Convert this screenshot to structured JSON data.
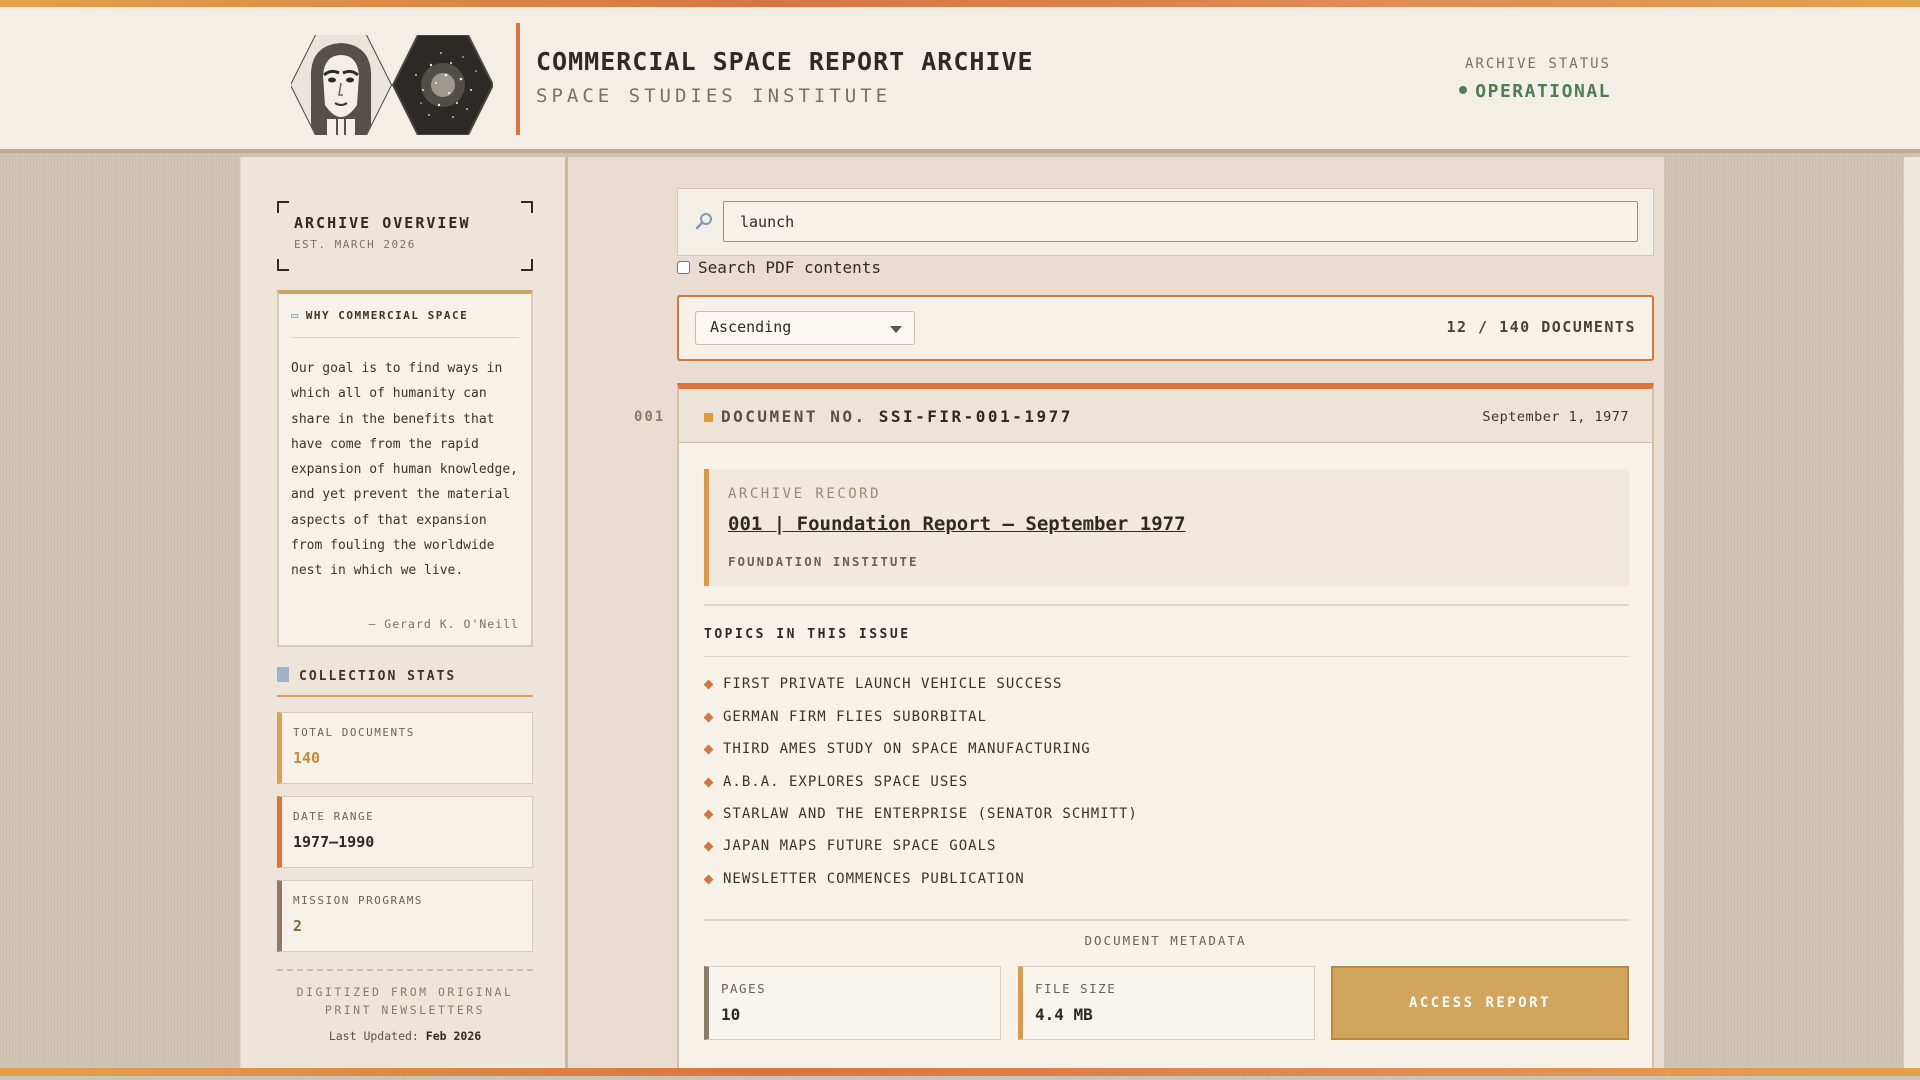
{
  "header": {
    "title": "COMMERCIAL SPACE REPORT ARCHIVE",
    "subtitle": "SPACE STUDIES INSTITUTE",
    "status_label": "ARCHIVE STATUS",
    "status_value": "OPERATIONAL"
  },
  "sidebar": {
    "overview_title": "ARCHIVE OVERVIEW",
    "overview_est": "EST. MARCH 2026",
    "quote_heading": "WHY COMMERCIAL SPACE",
    "quote_text": "Our goal is to find ways in which all of humanity can share in the benefits that have come from the rapid expansion of human knowledge, and yet prevent the material aspects of that expansion from fouling the worldwide nest in which we live.",
    "quote_author": "— Gerard K. O'Neill",
    "stats_heading": "COLLECTION STATS",
    "stats": [
      {
        "label": "TOTAL DOCUMENTS",
        "value": "140"
      },
      {
        "label": "DATE RANGE",
        "value": "1977–1990"
      },
      {
        "label": "MISSION PROGRAMS",
        "value": "2"
      }
    ],
    "digitized": "DIGITIZED FROM ORIGINAL PRINT NEWSLETTERS",
    "updated_label": "Last Updated:",
    "updated_value": "Feb 2026"
  },
  "search": {
    "value": "launch",
    "pdf_label": "Search PDF contents",
    "pdf_checked": false
  },
  "sort": {
    "selected": "Ascending",
    "count": "12 / 140 DOCUMENTS"
  },
  "document": {
    "index": "001",
    "doc_no_label": "DOCUMENT NO.",
    "doc_no": "SSI-FIR-001-1977",
    "date": "September 1, 1977",
    "record_label": "ARCHIVE RECORD",
    "record_title": "001 | Foundation Report — September 1977",
    "record_org": "FOUNDATION INSTITUTE",
    "topics_heading": "TOPICS IN THIS ISSUE",
    "topics": [
      "FIRST PRIVATE LAUNCH VEHICLE SUCCESS",
      "GERMAN FIRM FLIES SUBORBITAL",
      "THIRD AMES STUDY ON SPACE MANUFACTURING",
      "A.B.A. EXPLORES SPACE USES",
      "STARLAW AND THE ENTERPRISE (SENATOR SCHMITT)",
      "JAPAN MAPS FUTURE SPACE GOALS",
      "NEWSLETTER COMMENCES PUBLICATION"
    ],
    "metadata_heading": "DOCUMENT METADATA",
    "pages_label": "PAGES",
    "pages_value": "10",
    "size_label": "FILE SIZE",
    "size_value": "4.4 MB",
    "access_label": "ACCESS REPORT"
  },
  "colors": {
    "accent": "#d9743f",
    "gold": "#d1a55b",
    "status_green": "#4f7d54"
  }
}
